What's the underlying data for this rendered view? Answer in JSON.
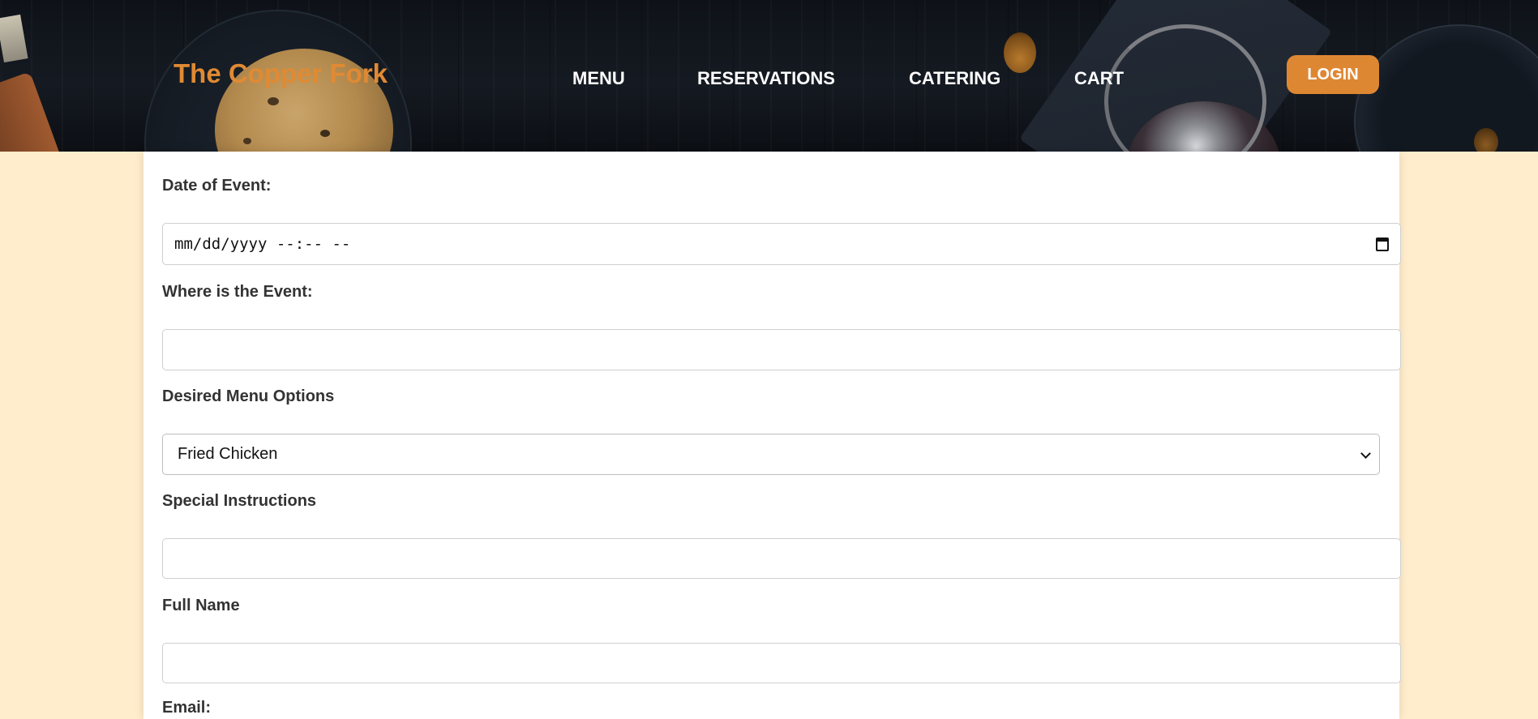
{
  "header": {
    "brand": "The Copper Fork",
    "nav": [
      {
        "label": "MENU"
      },
      {
        "label": "RESERVATIONS"
      },
      {
        "label": "CATERING"
      },
      {
        "label": "CART"
      }
    ],
    "login_label": "LOGIN",
    "colors": {
      "brand": "#e08a33",
      "login_bg": "#de8733",
      "page_bg": "#ffedcc"
    }
  },
  "form": {
    "date_of_event": {
      "label": "Date of Event:",
      "value": "mm/dd/yyyy --:-- --",
      "icon": "calendar-icon"
    },
    "location": {
      "label": "Where is the Event:",
      "value": ""
    },
    "menu_options": {
      "label": "Desired Menu Options",
      "selected": "Fried Chicken",
      "icon": "chevron-down-icon"
    },
    "special_instructions": {
      "label": "Special Instructions",
      "value": ""
    },
    "full_name": {
      "label": "Full Name",
      "value": ""
    },
    "email": {
      "label": "Email:"
    }
  }
}
